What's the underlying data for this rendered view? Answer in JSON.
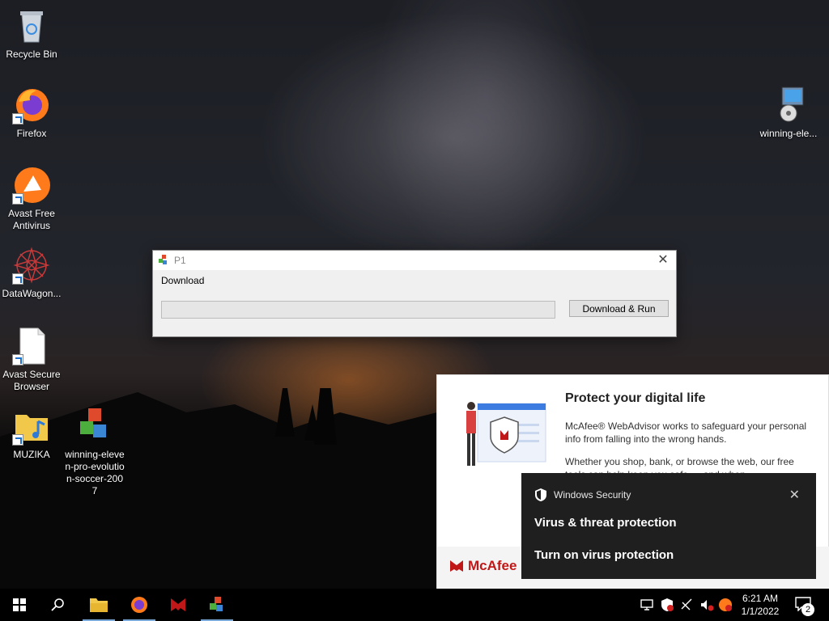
{
  "desktop": {
    "icons": [
      {
        "label": "Recycle Bin"
      },
      {
        "label": "Firefox"
      },
      {
        "label": "Avast Free Antivirus"
      },
      {
        "label": "DataWagon..."
      },
      {
        "label": "Avast Secure Browser"
      },
      {
        "label": "MUZIKA"
      },
      {
        "label": "winning-eleven-pro-evolution-soccer-2007"
      },
      {
        "label": "winning-ele..."
      }
    ]
  },
  "window": {
    "title": "P1",
    "label": "Download",
    "progress": 0,
    "button_label": "Download & Run",
    "close_icon": "close-icon"
  },
  "mcafee": {
    "title": "Protect your digital life",
    "paragraph1": "McAfee® WebAdvisor works to safeguard your personal info from falling into the wrong hands.",
    "paragraph2": "Whether you shop, bank, or browse the web, our free tools can help keep you safe — and when",
    "brand": "McAfee",
    "brand_color": "#c01818"
  },
  "toast": {
    "app_name": "Windows Security",
    "title": "Virus & threat protection",
    "body": "Turn on virus protection",
    "background": "#1f1f1f"
  },
  "taskbar": {
    "time": "6:21 AM",
    "date": "1/1/2022",
    "notification_count": "2",
    "pinned": [
      "start-icon",
      "search-icon",
      "file-explorer-icon",
      "firefox-icon",
      "mcafee-icon",
      "p1-app-icon"
    ]
  }
}
